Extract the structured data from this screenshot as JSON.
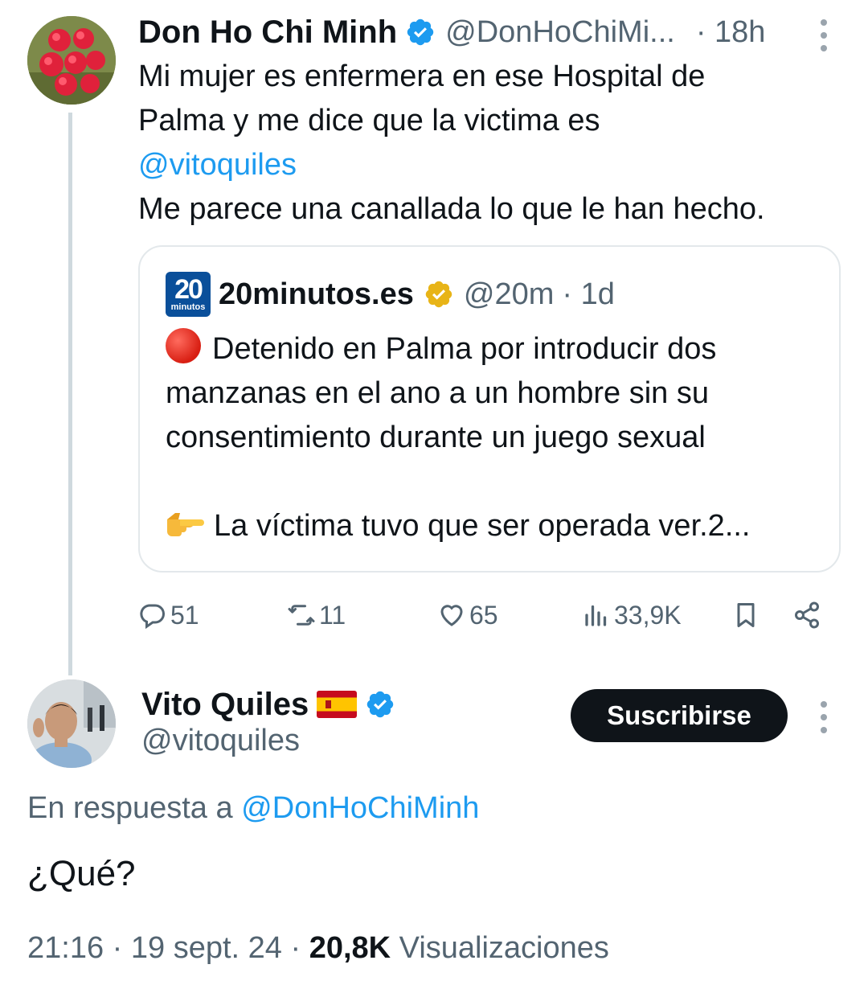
{
  "tweet1": {
    "author_name": "Don Ho Chi Minh",
    "author_handle": "@DonHoChiMi...",
    "time": "· 18h",
    "text_line1": "Mi mujer es enfermera en ese Hospital de",
    "text_line2": "Palma y me dice que la victima es",
    "mention": "@vitoquiles",
    "text_line4": "Me parece una canallada lo que le han hecho.",
    "verified_icon": "verified-badge-blue",
    "more_icon": "more-vertical-icon"
  },
  "quote": {
    "logo_big": "20",
    "logo_small": "minutos",
    "author_name": "20minutos.es",
    "author_handle": "@20m",
    "time": "· 1d",
    "badge_icon": "verified-badge-gold",
    "line1": "Detenido en Palma por introducir dos",
    "line2": "manzanas en el ano a un hombre sin su",
    "line3": "consentimiento durante un juego sexual",
    "line4": "La víctima tuvo que ser operada ver.2...",
    "emoji1": "red-circle-emoji",
    "emoji2": "pointing-hand-emoji"
  },
  "actions": {
    "replies": "51",
    "retweets": "11",
    "likes": "65",
    "views": "33,9K"
  },
  "tweet2": {
    "author_name": "Vito Quiles",
    "flag": "spain-flag-emoji",
    "author_handle": "@vitoquiles",
    "subscribe_label": "Suscribirse",
    "reply_prefix": "En respuesta a",
    "reply_mention": "@DonHoChiMinh",
    "text": "¿Qué?",
    "time": "21:16",
    "date": "19 sept. 24",
    "separator": "·",
    "views_count": "20,8K",
    "views_label": "Visualizaciones"
  },
  "colors": {
    "accent": "#1d9bf0",
    "muted": "#536471",
    "text": "#0f1419",
    "border": "#e3e8eb",
    "button_bg": "#0f1419"
  }
}
